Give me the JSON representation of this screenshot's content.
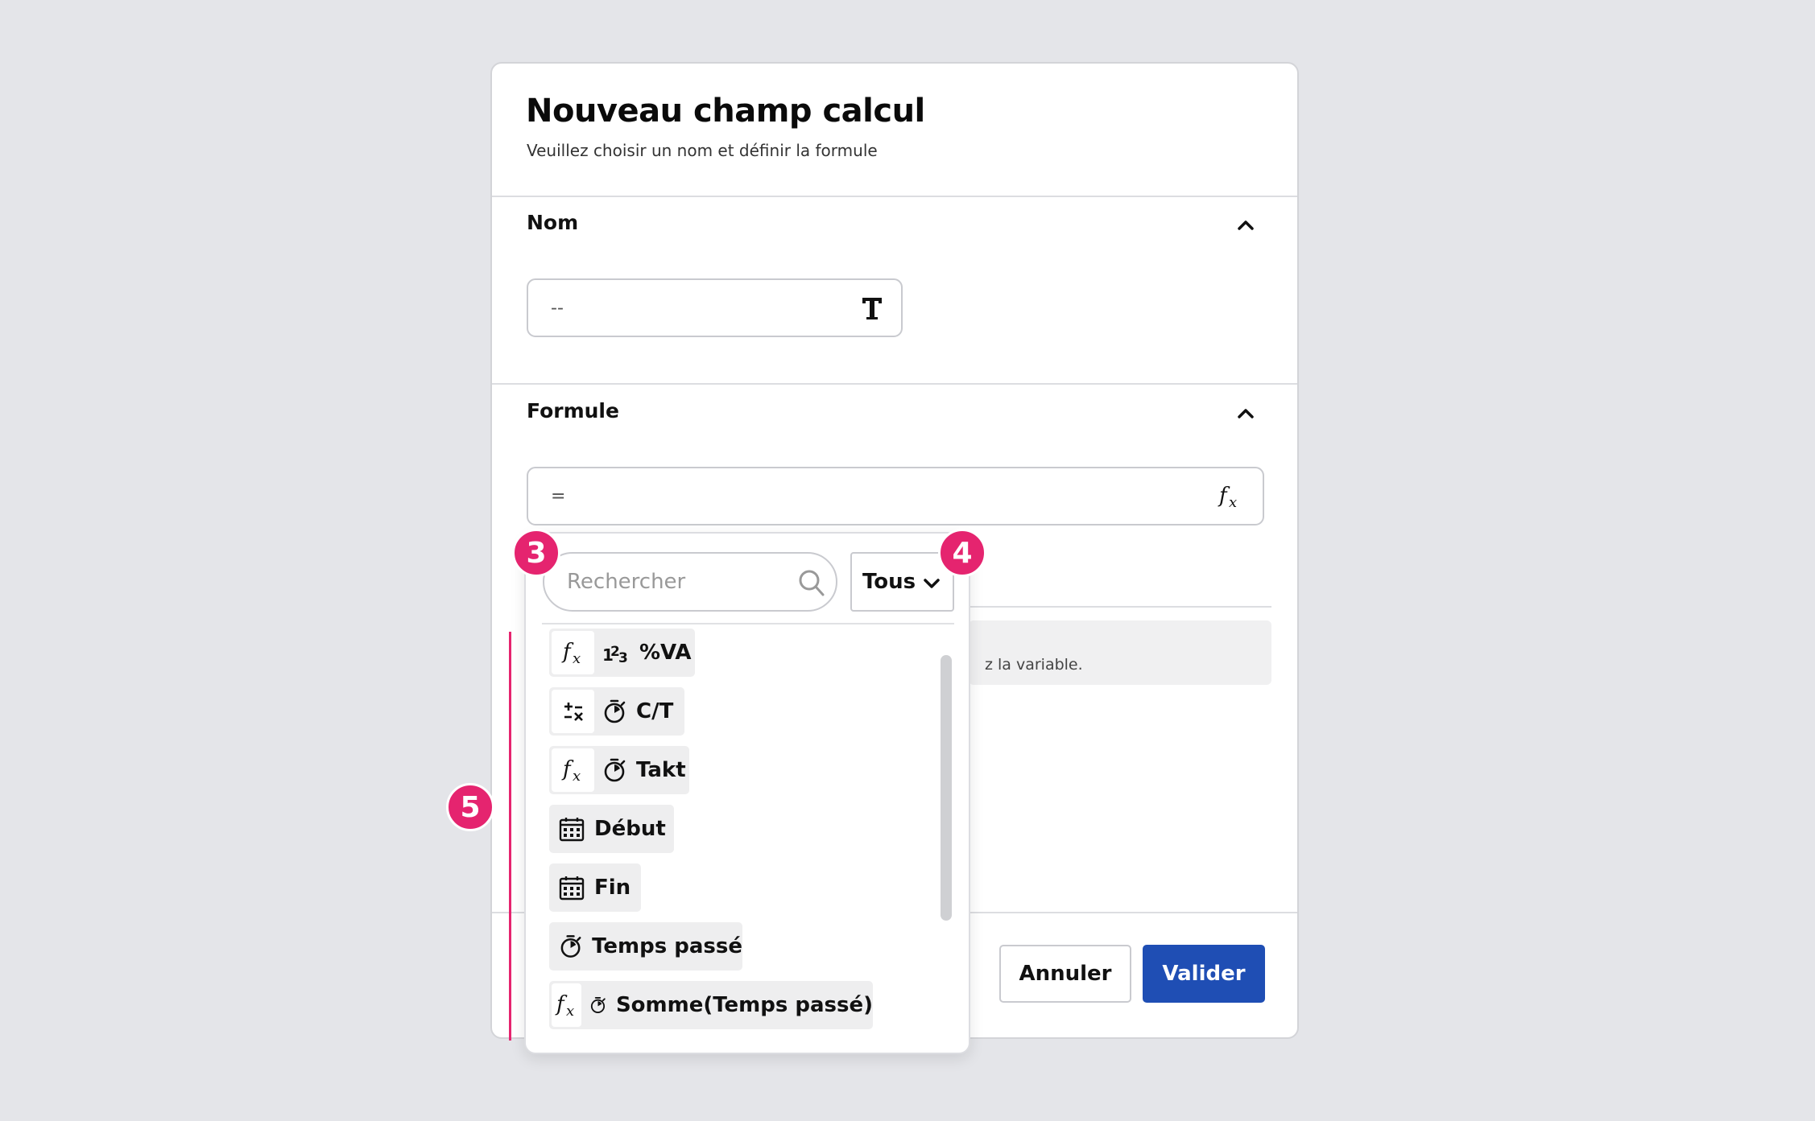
{
  "modal": {
    "title": "Nouveau champ calcul",
    "subtitle": "Veuillez choisir un nom et définir la formule"
  },
  "name_section": {
    "title": "Nom",
    "value": "--"
  },
  "formula_section": {
    "title": "Formule",
    "value": "=",
    "info_text": "z la variable."
  },
  "dropdown": {
    "search_placeholder": "Rechercher",
    "filter_value": "Tous",
    "items": [
      {
        "label": "%VA",
        "icons": [
          "fx-icon",
          "numbers-icon"
        ]
      },
      {
        "label": "C/T",
        "icons": [
          "operators-icon",
          "stopwatch-icon"
        ]
      },
      {
        "label": "Takt",
        "icons": [
          "fx-icon",
          "stopwatch-icon"
        ]
      },
      {
        "label": "Début",
        "icons": [
          "calendar-icon"
        ]
      },
      {
        "label": "Fin",
        "icons": [
          "calendar-icon"
        ]
      },
      {
        "label": "Temps passé",
        "icons": [
          "stopwatch-icon"
        ]
      },
      {
        "label": "Somme(Temps passé)",
        "icons": [
          "fx-icon",
          "stopwatch-icon"
        ]
      }
    ]
  },
  "buttons": {
    "cancel": "Annuler",
    "validate": "Valider"
  },
  "markers": [
    "3",
    "4",
    "5"
  ],
  "colors": {
    "primary": "#1f4eb4",
    "marker": "#e5246f",
    "background": "#e4e5e9"
  }
}
